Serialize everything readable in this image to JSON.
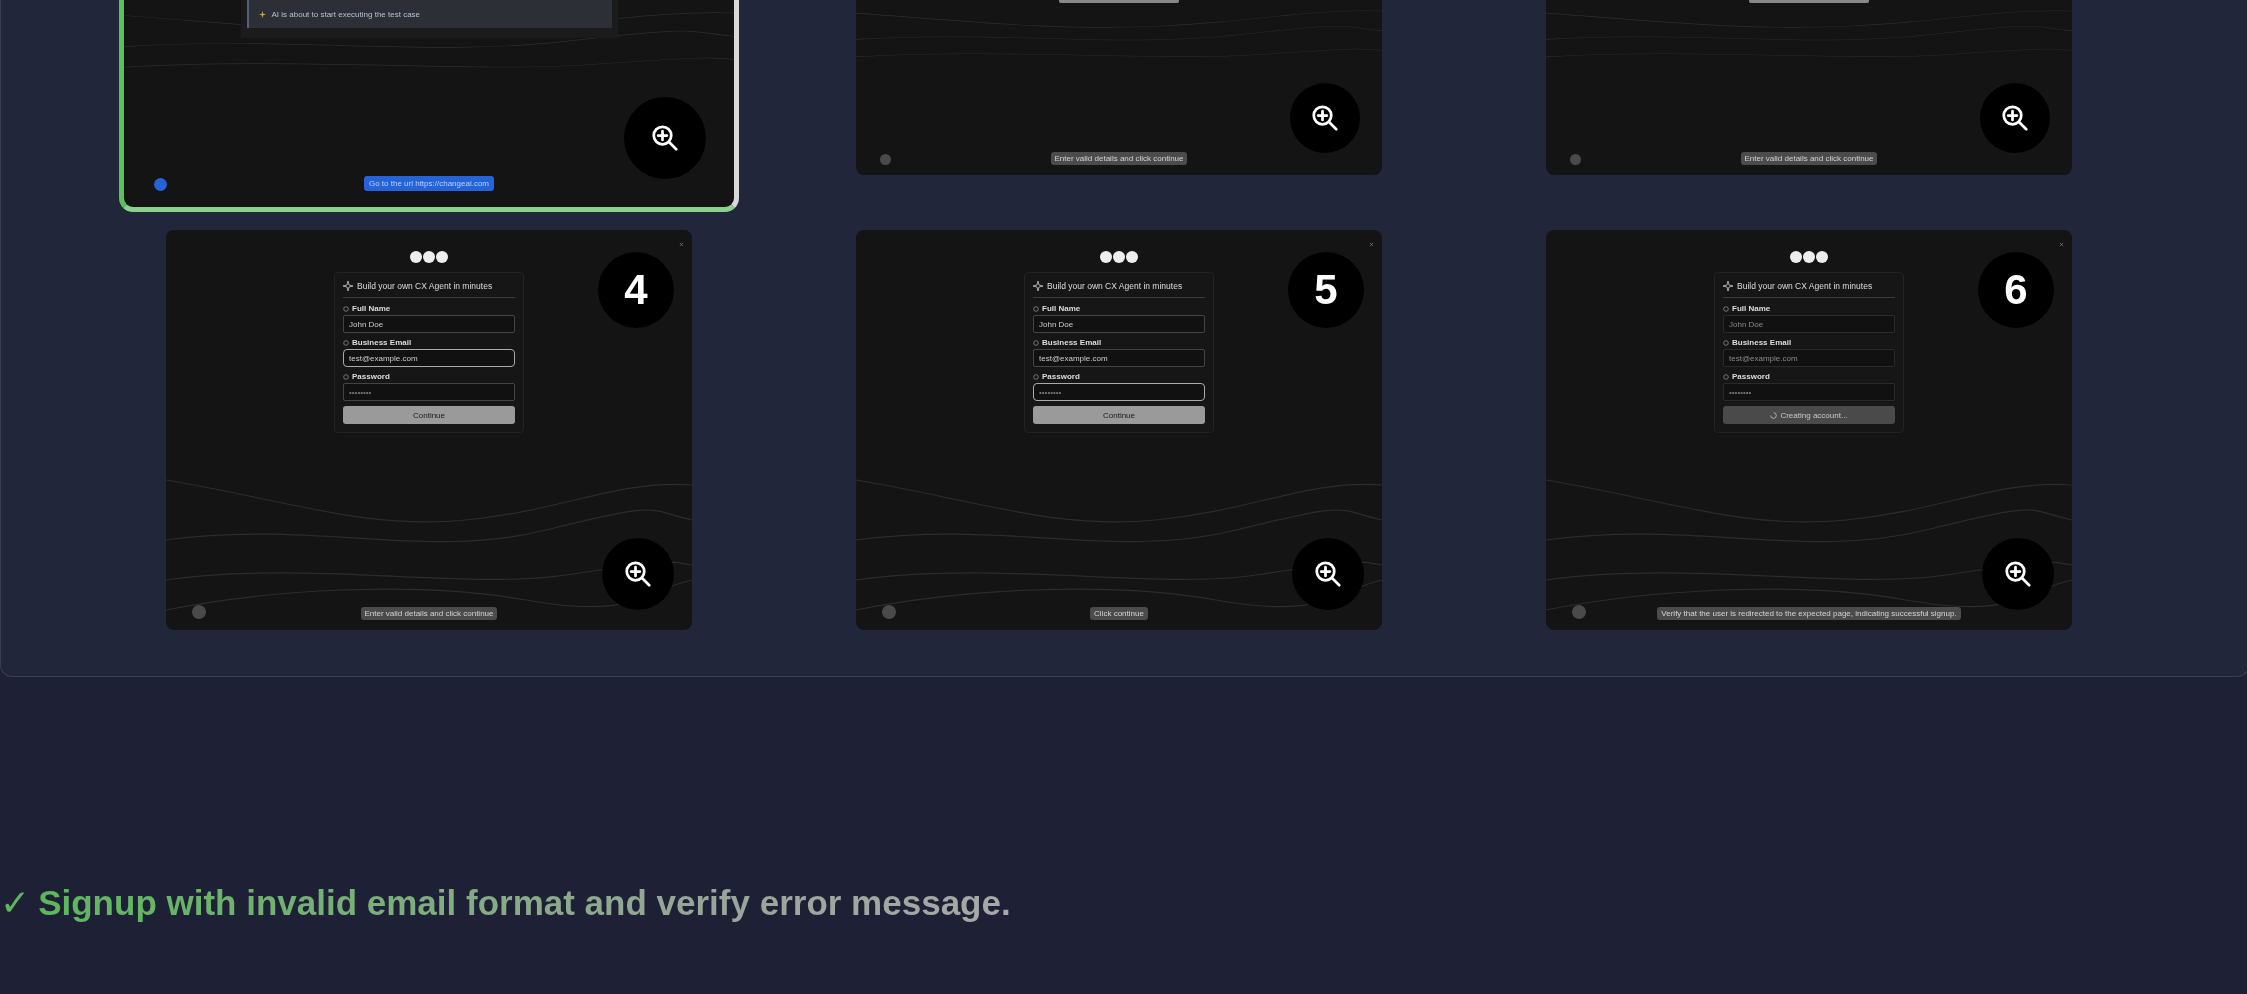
{
  "cards": [
    {
      "kind": "message",
      "selected": true,
      "message": "AI is about to start executing the test case",
      "caption": "Go to the url https://changeai.com"
    },
    {
      "kind": "form_bottom",
      "selected": false,
      "caption": "Enter valid details and click continue"
    },
    {
      "kind": "form_bottom",
      "selected": false,
      "caption": "Enter valid details and click continue"
    },
    {
      "kind": "form",
      "selected": false,
      "number": "4",
      "title": "Build your own CX Agent in minutes",
      "disabled": false,
      "fields": [
        {
          "label": "Full Name",
          "value": "John Doe",
          "focused": false
        },
        {
          "label": "Business Email",
          "value": "test@example.com",
          "focused": true
        },
        {
          "label": "Password",
          "placeholder": "••••••••",
          "focused": false
        }
      ],
      "button": {
        "label": "Continue",
        "loading": false
      },
      "caption": "Enter valid details and click continue"
    },
    {
      "kind": "form",
      "selected": false,
      "number": "5",
      "title": "Build your own CX Agent in minutes",
      "disabled": false,
      "fields": [
        {
          "label": "Full Name",
          "value": "John Doe",
          "focused": false
        },
        {
          "label": "Business Email",
          "value": "test@example.com",
          "focused": false
        },
        {
          "label": "Password",
          "placeholder": "••••••••",
          "focused": true
        }
      ],
      "button": {
        "label": "Continue",
        "loading": false
      },
      "caption": "Click continue"
    },
    {
      "kind": "form",
      "selected": false,
      "number": "6",
      "title": "Build your own CX Agent in minutes",
      "disabled": true,
      "fields": [
        {
          "label": "Full Name",
          "value": "John Doe",
          "focused": false
        },
        {
          "label": "Business Email",
          "value": "test@example.com",
          "focused": false
        },
        {
          "label": "Password",
          "placeholder": "••••••••",
          "focused": false
        }
      ],
      "button": {
        "label": "Creating account...",
        "loading": true
      },
      "caption": "Verify that the user is redirected to the expected page, indicating successful signup."
    }
  ],
  "result": {
    "passed": true,
    "mark": "✓",
    "text": "Signup with invalid email format and verify error message."
  }
}
